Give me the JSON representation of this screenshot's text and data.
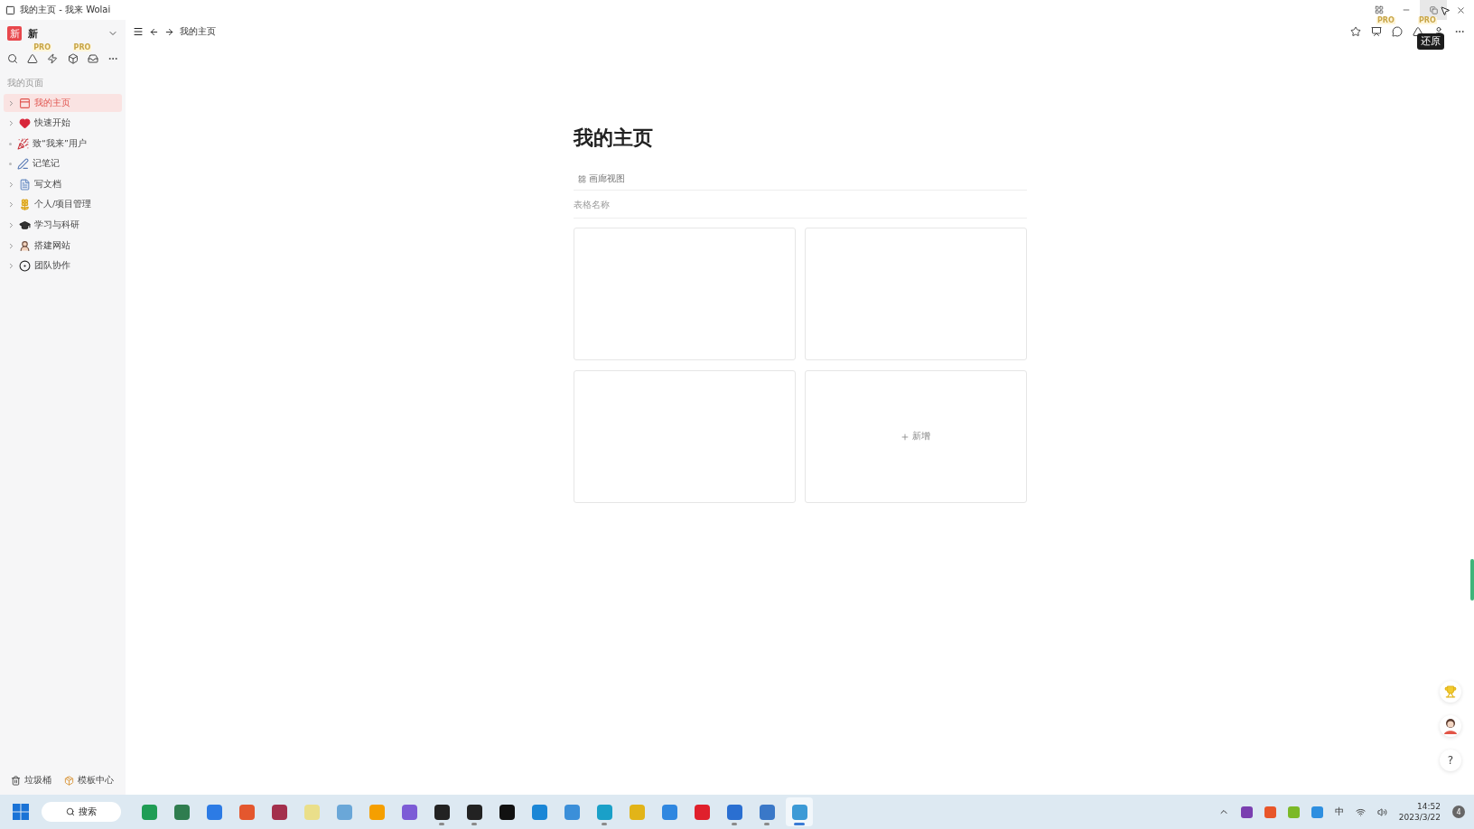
{
  "window": {
    "title": "我的主页 - 我来 Wolai",
    "tooltip": "还原"
  },
  "sidebar": {
    "workspace": {
      "logo": "新",
      "name": "新"
    },
    "toolbar": [
      {
        "kind": "search"
      },
      {
        "kind": "triangle",
        "badge": "PRO"
      },
      {
        "kind": "bolt"
      },
      {
        "kind": "box",
        "badge": "PRO"
      },
      {
        "kind": "inbox"
      },
      {
        "kind": "more"
      }
    ],
    "section_label": "我的页面",
    "pages": [
      {
        "label": "我的主页",
        "selected": true,
        "expandable": true
      },
      {
        "label": "快速开始",
        "selected": false,
        "expandable": true
      },
      {
        "label": "致“我来”用户",
        "selected": false,
        "expandable": false
      },
      {
        "label": "记笔记",
        "selected": false,
        "expandable": false
      },
      {
        "label": "写文档",
        "selected": false,
        "expandable": true
      },
      {
        "label": "个人/项目管理",
        "selected": false,
        "expandable": true
      },
      {
        "label": "学习与科研",
        "selected": false,
        "expandable": true
      },
      {
        "label": "搭建网站",
        "selected": false,
        "expandable": true
      },
      {
        "label": "团队协作",
        "selected": false,
        "expandable": true
      }
    ],
    "footer": [
      {
        "kind": "trash",
        "label": "垃圾桶"
      },
      {
        "kind": "template",
        "label": "模板中心"
      }
    ]
  },
  "topbar": {
    "breadcrumb": "我的主页",
    "actions": [
      {
        "kind": "star"
      },
      {
        "kind": "presentation",
        "badge": "PRO"
      },
      {
        "kind": "comment"
      },
      {
        "kind": "triangle",
        "badge": "PRO"
      },
      {
        "kind": "person"
      },
      {
        "kind": "more"
      }
    ]
  },
  "page": {
    "title": "我的主页",
    "view_tab": "画廊视图",
    "table_name": "表格名称",
    "cards": [
      {
        "kind": "empty"
      },
      {
        "kind": "empty"
      },
      {
        "kind": "empty"
      },
      {
        "kind": "add",
        "label": "新增"
      }
    ]
  },
  "help": "?",
  "taskbar": {
    "search": "搜索",
    "apps": [
      {
        "running": false,
        "active": false
      },
      {
        "running": false,
        "active": false
      },
      {
        "running": false,
        "active": false
      },
      {
        "running": false,
        "active": false
      },
      {
        "running": false,
        "active": false
      },
      {
        "running": false,
        "active": false
      },
      {
        "running": false,
        "active": false
      },
      {
        "running": false,
        "active": false
      },
      {
        "running": false,
        "active": false
      },
      {
        "running": true,
        "active": false
      },
      {
        "running": true,
        "active": false
      },
      {
        "running": false,
        "active": false
      },
      {
        "running": false,
        "active": false
      },
      {
        "running": false,
        "active": false
      },
      {
        "running": true,
        "active": false
      },
      {
        "running": false,
        "active": false
      },
      {
        "running": false,
        "active": false
      },
      {
        "running": false,
        "active": false
      },
      {
        "running": true,
        "active": false
      },
      {
        "running": true,
        "active": false
      },
      {
        "running": true,
        "active": true
      }
    ],
    "ime": "中",
    "time": "14:52",
    "date": "2023/3/22",
    "notifications": "4"
  }
}
